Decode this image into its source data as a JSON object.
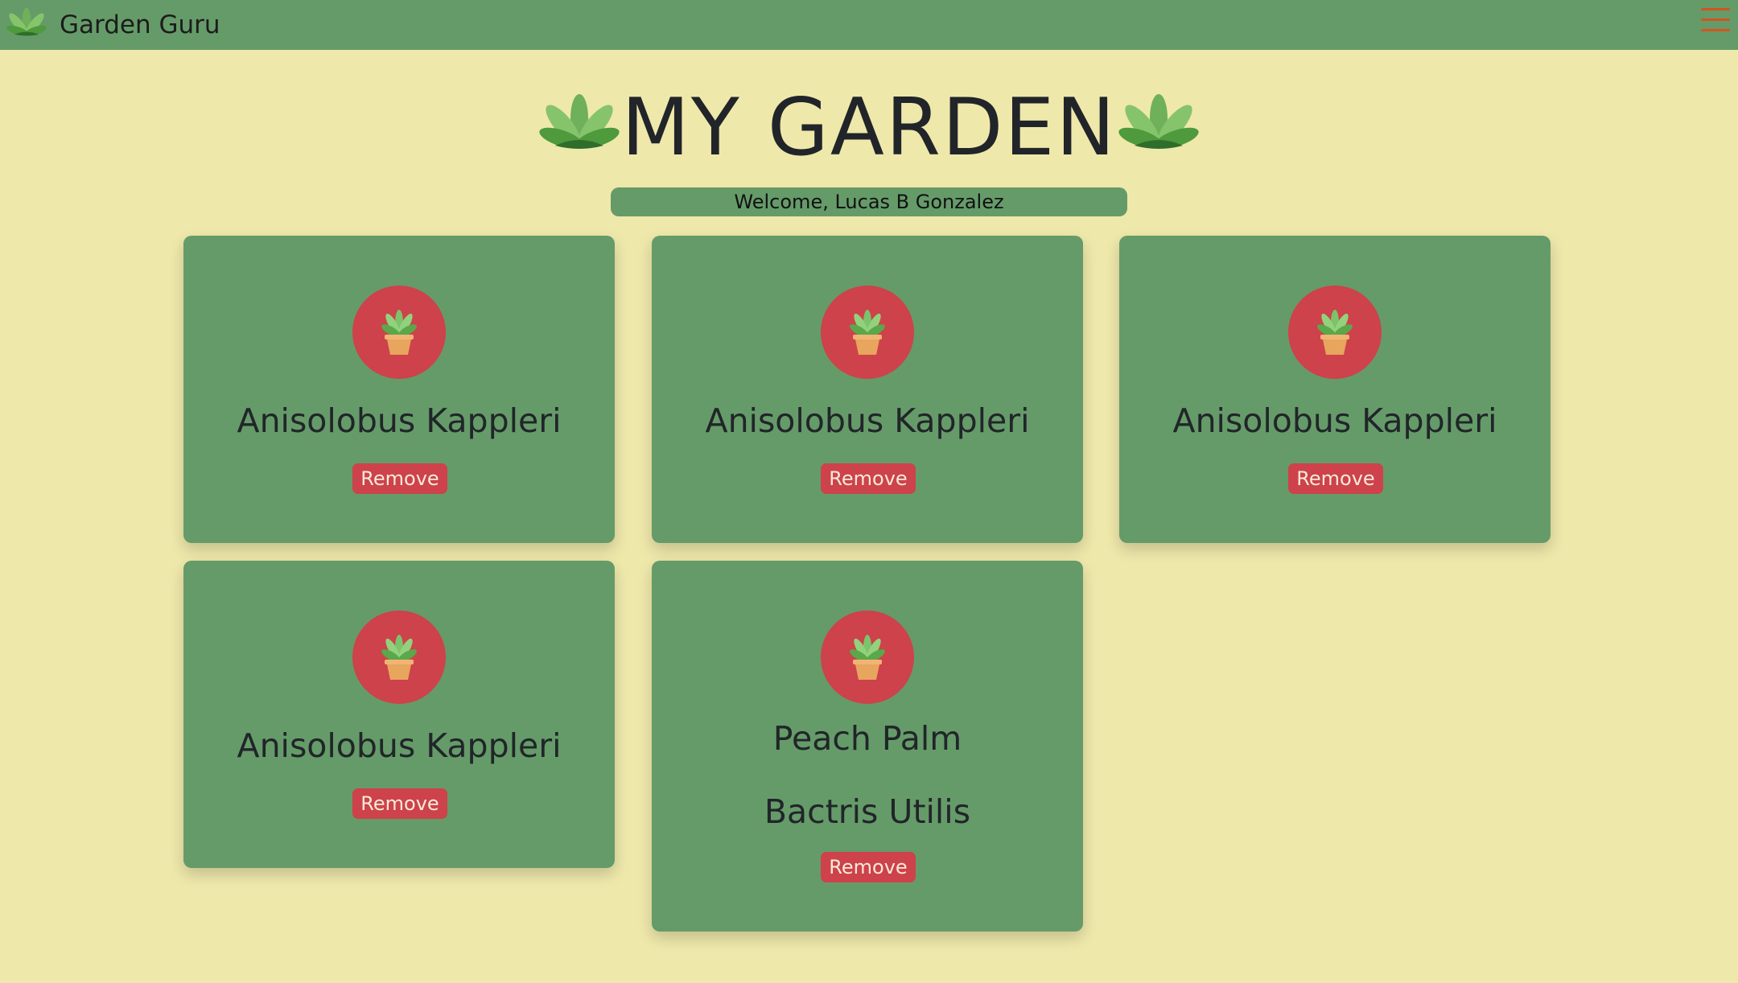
{
  "navbar": {
    "brand": "Garden Guru",
    "menu_icon": "hamburger-menu-icon",
    "logo_icon": "leaf-logo-icon"
  },
  "page": {
    "title": "MY GARDEN",
    "welcome": "Welcome, Lucas B Gonzalez"
  },
  "plants": [
    {
      "name": "Anisolobus Kappleri",
      "remove_label": "Remove"
    },
    {
      "name": "Anisolobus Kappleri",
      "remove_label": "Remove"
    },
    {
      "name": "Anisolobus Kappleri",
      "remove_label": "Remove"
    },
    {
      "name": "Anisolobus Kappleri",
      "remove_label": "Remove"
    },
    {
      "name": "Peach Palm",
      "secondary_name": "Bactris Utilis",
      "remove_label": "Remove"
    }
  ],
  "colors": {
    "background": "#efe8ab",
    "card": "#659b69",
    "accent_red": "#cd424b",
    "menu_orange": "#d4541f"
  }
}
